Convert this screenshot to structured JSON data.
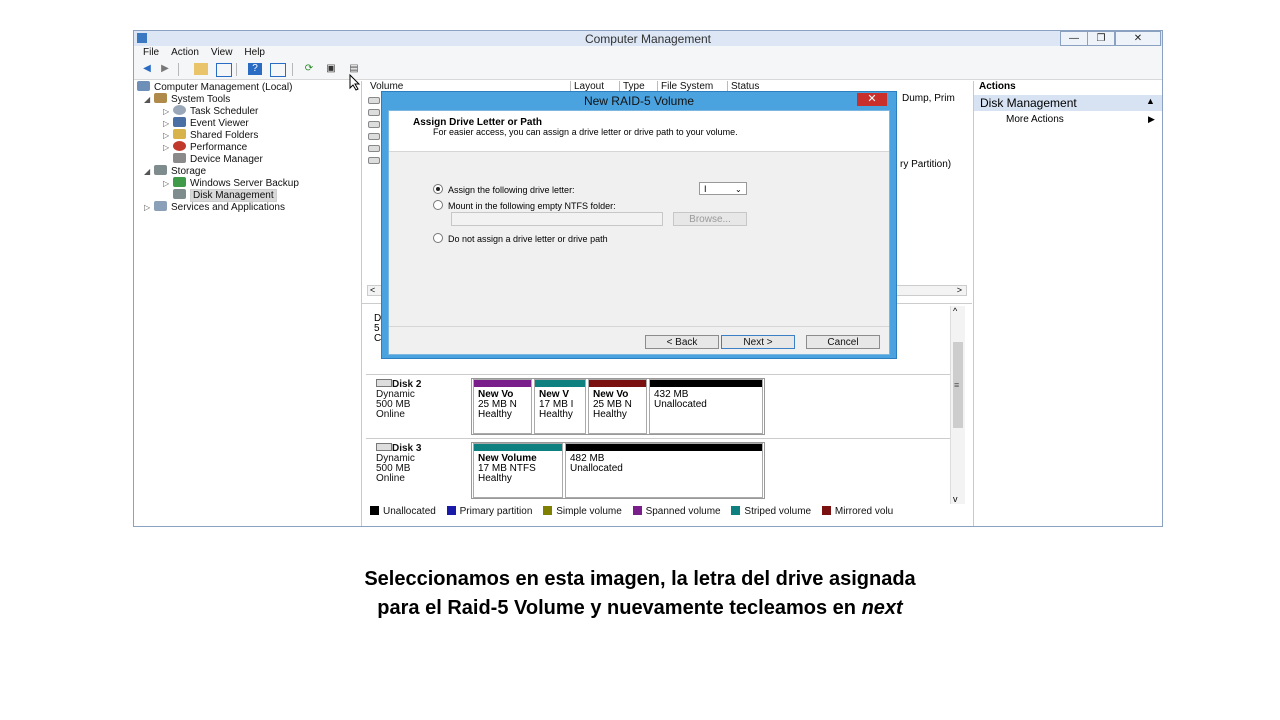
{
  "window": {
    "title": "Computer Management",
    "min_glyph": "—",
    "max_glyph": "❐",
    "close_glyph": "✕"
  },
  "menu": [
    "File",
    "Action",
    "View",
    "Help"
  ],
  "toolbar_icons": [
    "back-arrow-icon",
    "forward-arrow-icon",
    "up-folder-icon",
    "show-hide-tree-icon",
    "help-icon",
    "console-icon",
    "refresh-icon",
    "properties-icon",
    "disk-icon"
  ],
  "tree": [
    {
      "label": "Computer Management (Local)",
      "icon": "computer-icon"
    },
    {
      "label": "System Tools",
      "icon": "tools-icon"
    },
    {
      "label": "Task Scheduler",
      "icon": "clock-icon"
    },
    {
      "label": "Event Viewer",
      "icon": "event-viewer-icon"
    },
    {
      "label": "Shared Folders",
      "icon": "shared-folder-icon"
    },
    {
      "label": "Performance",
      "icon": "performance-icon"
    },
    {
      "label": "Device Manager",
      "icon": "device-manager-icon"
    },
    {
      "label": "Storage",
      "icon": "storage-icon"
    },
    {
      "label": "Windows Server Backup",
      "icon": "backup-icon"
    },
    {
      "label": "Disk Management",
      "icon": "disk-management-icon"
    },
    {
      "label": "Services and Applications",
      "icon": "services-icon"
    }
  ],
  "columns": [
    "Volume",
    "Layout",
    "Type",
    "File System",
    "Status"
  ],
  "partial_text": {
    "status_row1": "Dump, Prim",
    "status_row2": "ry Partition)",
    "left_letters": [
      "D",
      "5",
      "C"
    ]
  },
  "disks": [
    {
      "name": "Disk 2",
      "type": "Dynamic",
      "size": "500 MB",
      "status": "Online",
      "partitions": [
        {
          "l1": "New Vo",
          "l2": "25 MB N",
          "l3": "Healthy",
          "color": "#7a1e8c"
        },
        {
          "l1": "New V",
          "l2": "17 MB I",
          "l3": "Healthy",
          "color": "#0f8080"
        },
        {
          "l1": "New Vo",
          "l2": "25 MB N",
          "l3": "Healthy",
          "color": "#7a1010"
        },
        {
          "l1": "",
          "l2": "432 MB",
          "l3": "Unallocated",
          "color": "#000000"
        }
      ]
    },
    {
      "name": "Disk 3",
      "type": "Dynamic",
      "size": "500 MB",
      "status": "Online",
      "partitions": [
        {
          "l1": "New Volume",
          "l2": "17 MB NTFS",
          "l3": "Healthy",
          "color": "#0f8080"
        },
        {
          "l1": "",
          "l2": "482 MB",
          "l3": "Unallocated",
          "color": "#000000"
        }
      ]
    }
  ],
  "legend": [
    {
      "label": "Unallocated",
      "color": "#000000"
    },
    {
      "label": "Primary partition",
      "color": "#1a1aa8"
    },
    {
      "label": "Simple volume",
      "color": "#808000"
    },
    {
      "label": "Spanned volume",
      "color": "#7a1e8c"
    },
    {
      "label": "Striped volume",
      "color": "#0f8080"
    },
    {
      "label": "Mirrored volu",
      "color": "#7a1010"
    }
  ],
  "actions": {
    "title": "Actions",
    "section": "Disk Management",
    "more": "More Actions"
  },
  "dialog": {
    "title": "New RAID-5 Volume",
    "close_glyph": "✕",
    "heading": "Assign Drive Letter or Path",
    "subheading": "For easier access, you can assign a drive letter or drive path to your volume.",
    "option1": "Assign the following drive letter:",
    "drive_letter": "I",
    "option2": "Mount in the following empty NTFS folder:",
    "browse": "Browse...",
    "option3": "Do not assign a drive letter or drive path",
    "back": "< Back",
    "next": "Next >",
    "cancel": "Cancel"
  },
  "caption": {
    "line1": "Seleccionamos en esta imagen, la letra del drive asignada",
    "line2_prefix": "para el Raid-5 Volume y nuevamente tecleamos en ",
    "line2_italic": "next"
  }
}
